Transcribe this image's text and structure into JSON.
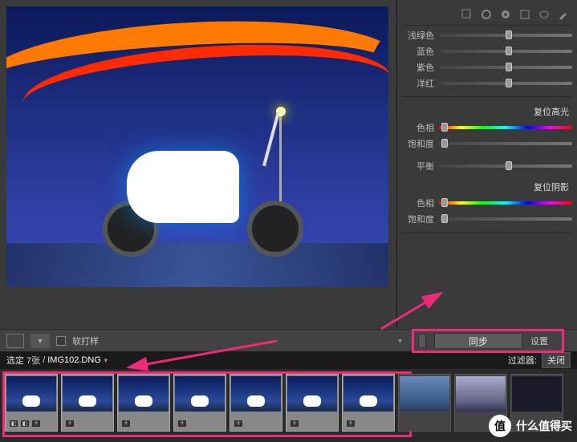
{
  "panel": {
    "color_sliders": [
      {
        "label": "浅绿色"
      },
      {
        "label": "蓝色"
      },
      {
        "label": "紫色"
      },
      {
        "label": "洋红"
      }
    ],
    "highlights": {
      "title": "复位高光",
      "hue": "色相",
      "saturation": "饱和度"
    },
    "balance": "平衡",
    "shadows": {
      "title": "复位阴影",
      "hue": "色相",
      "saturation": "饱和度"
    }
  },
  "toolbar": {
    "soft_proof": "软打样",
    "sync": "同步",
    "settings": "设置"
  },
  "status": {
    "selection": "选定 7张",
    "filename": "IMG102.DNG",
    "filter_label": "过滤器:",
    "filter_value": "关闭"
  },
  "watermark": {
    "icon": "值",
    "text": "什么值得买"
  }
}
